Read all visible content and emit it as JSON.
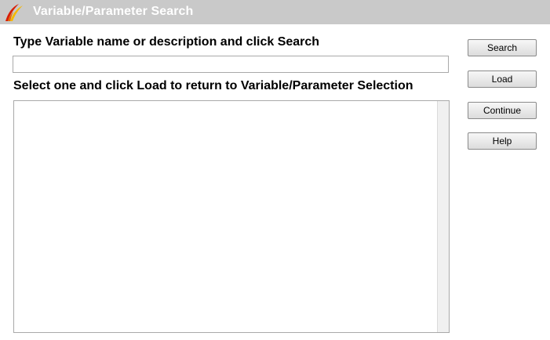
{
  "window": {
    "title": "Variable/Parameter Search",
    "icon": "app-logo-icon"
  },
  "search": {
    "instruction": "Type Variable name or description and click Search",
    "value": "",
    "placeholder": ""
  },
  "results": {
    "instruction": "Select one and click Load to return to Variable/Parameter Selection",
    "items": []
  },
  "buttons": {
    "search": "Search",
    "load": "Load",
    "continue": "Continue",
    "help": "Help"
  },
  "colors": {
    "titlebar": "#c9c9c9",
    "title_text": "#ffffff",
    "logo_red": "#d81e05",
    "logo_yellow": "#f5b800"
  }
}
